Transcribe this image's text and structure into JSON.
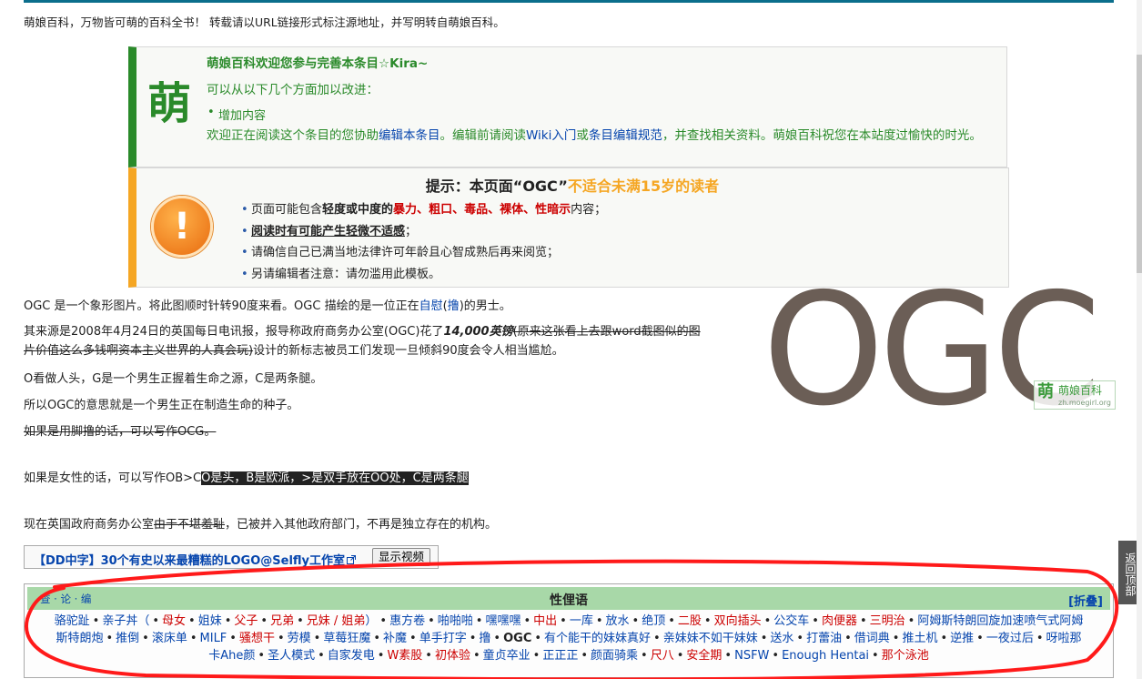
{
  "disclaimer": "萌娘百科，万物皆可萌的百科全书！ 转载请以URL链接形式标注源地址，并写明转自萌娘百科。",
  "notice_edit": {
    "icon_char": "萌",
    "title": "萌娘百科欢迎您参与完善本条目☆Kira~",
    "subtitle": "可以从以下几个方面加以改进：",
    "bullet": "增加内容",
    "desc_1": "欢迎正在阅读这个条目的您协助",
    "desc_link_1": "编辑本条目",
    "desc_2": "。编辑前请阅读",
    "desc_link_2": "Wiki入门",
    "desc_3": "或",
    "desc_link_3": "条目编辑规范",
    "desc_4": "，并查找相关资料。萌娘百科祝您在本站度过愉快的时光。",
    "accent_color": "#2a8a2a"
  },
  "notice_age": {
    "icon_char": "!",
    "title_prefix": "提示：本页面“OGC”",
    "title_age": "不适合未满15岁的读者",
    "item1_pre": "页面可能包含",
    "item1_degree": "轻度或中度的",
    "item1_tags": [
      "暴力",
      "、",
      "粗口",
      "、",
      "毒品",
      "、",
      "裸体",
      "、",
      "性暗示"
    ],
    "item1_post": "内容；",
    "item2_bold": "阅读时有可能产生轻微不适感",
    "item2_post": "；",
    "item3": "请确信自己已满当地法律许可年龄且心智成熟后再来阅览；",
    "item4": "另请编辑者注意：请勿滥用此模板。",
    "accent_color": "#f5a623"
  },
  "logo": {
    "text": "OGC",
    "watermark_char": "萌",
    "watermark_name": "萌娘百科",
    "watermark_url": "zh.moegirl.org"
  },
  "body": {
    "p1_a": "OGC 是一个象形图片。将此图顺时针转90度来看。OGC 描绘的是一位正在",
    "p1_link1": "自慰",
    "p1_b": "(",
    "p1_link2": "撸",
    "p1_c": ")的男士。",
    "p2_a": "其来源是2008年4月24日的英国每日电讯报，报导称政府商务办公室(OGC)花了",
    "p2_bold": "14,000英镑",
    "p2_strike": "(原来这张看上去跟word截图似的图",
    "p2_strike2": "片价值这么多钱啊资本主义世界的人真会玩)",
    "p2_b": "设计的新标志被员工们发现一旦倾斜90度会令人相当尴尬。",
    "p3": "O看做人头，G是一个男生正握着生命之源，C是两条腿。",
    "p4": "所以OGC的意思就是一个男生正在制造生命的种子。",
    "p5_strike": "如果是用脚撸的话，可以写作OCG。",
    "p6_a": "如果是女性的话，可以写作OB>C",
    "p6_inv": "O是头，B是欧派，>是双手放在OO处，C是两条腿",
    "p7_a": "现在英国政府商务办公室",
    "p7_strike": "由于不堪羞耻",
    "p7_b": "，已被并入其他政府部门，不再是独立存在的机构。"
  },
  "video": {
    "link_text": "【DD中字】30个有史以来最糟糕的LOGO@Selfly工作室",
    "external_icon": "external-link-icon",
    "button_label": "显示视频"
  },
  "navbox": {
    "vde": "查 · 论 · 编",
    "title": "性俚语",
    "fold_label": "[折叠]",
    "line1": [
      {
        "t": "骆驼趾",
        "red": false
      },
      {
        "t": "亲子丼（",
        "red": false
      },
      {
        "t": "母女",
        "red": true
      },
      {
        "t": "姐妹",
        "red": false
      },
      {
        "t": "父子",
        "red": true
      },
      {
        "t": "兄弟",
        "red": true
      },
      {
        "t": "兄妹 / 姐弟",
        "red": true
      },
      {
        "t": "）",
        "red": false,
        "nosep": true
      },
      {
        "t": "惠方卷",
        "red": false
      },
      {
        "t": "啪啪啪",
        "red": false
      },
      {
        "t": "嘿嘿嘿",
        "red": false
      },
      {
        "t": "中出",
        "red": true
      },
      {
        "t": "一库",
        "red": false
      },
      {
        "t": "放水",
        "red": false
      },
      {
        "t": "绝顶",
        "red": false
      },
      {
        "t": "二股",
        "red": true
      },
      {
        "t": "双向插头",
        "red": true
      },
      {
        "t": "公交车",
        "red": false
      },
      {
        "t": "肉便器",
        "red": true
      },
      {
        "t": "三明治",
        "red": true
      },
      {
        "t": "阿姆斯特朗回旋加速喷气式阿姆",
        "red": false
      }
    ],
    "line2": [
      {
        "t": "斯特朗炮",
        "red": false
      },
      {
        "t": "推倒",
        "red": false
      },
      {
        "t": "滚床单",
        "red": false
      },
      {
        "t": "MILF",
        "red": false
      },
      {
        "t": "骚想干",
        "red": true
      },
      {
        "t": "劳模",
        "red": false
      },
      {
        "t": "草莓狂魔",
        "red": false
      },
      {
        "t": "补魔",
        "red": false
      },
      {
        "t": "单手打字",
        "red": false
      },
      {
        "t": "撸",
        "red": false
      },
      {
        "t": "OGC",
        "red": false,
        "cur": true
      },
      {
        "t": "有个能干的妹妹真好",
        "red": false
      },
      {
        "t": "亲妹妹不如干妹妹",
        "red": false
      },
      {
        "t": "送水",
        "red": false
      },
      {
        "t": "打蕾油",
        "red": false
      },
      {
        "t": "借词典",
        "red": false
      },
      {
        "t": "推土机",
        "red": false
      },
      {
        "t": "逆推",
        "red": false
      },
      {
        "t": "一夜过后",
        "red": false
      },
      {
        "t": "呀啦那",
        "red": false
      }
    ],
    "line3": [
      {
        "t": "卡Ahe颜",
        "red": false
      },
      {
        "t": "圣人模式",
        "red": false
      },
      {
        "t": "自家发电",
        "red": false
      },
      {
        "t": "W素股",
        "red": true
      },
      {
        "t": "初体验",
        "red": true
      },
      {
        "t": "童贞卒业",
        "red": false
      },
      {
        "t": "正正正",
        "red": false
      },
      {
        "t": "颜面骑乘",
        "red": false
      },
      {
        "t": "尺八",
        "red": true
      },
      {
        "t": "安全期",
        "red": true
      },
      {
        "t": "NSFW",
        "red": false
      },
      {
        "t": "Enough Hentai",
        "red": false
      },
      {
        "t": "那个泳池",
        "red": true
      }
    ]
  },
  "backtop": "返回顶部",
  "annotation_color": "#ff1a1a"
}
